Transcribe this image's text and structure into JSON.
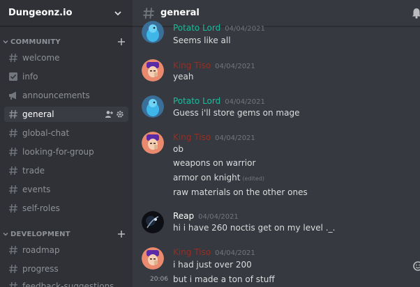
{
  "server": {
    "name": "Dungeonz.io"
  },
  "categories": [
    {
      "label": "COMMUNITY"
    },
    {
      "label": "DEVELOPMENT"
    }
  ],
  "channels": [
    {
      "label": "welcome",
      "icon": "hash-icon"
    },
    {
      "label": "info",
      "icon": "rules-icon"
    },
    {
      "label": "announcements",
      "icon": "megaphone-icon"
    },
    {
      "label": "general",
      "icon": "hash-icon",
      "active": true
    },
    {
      "label": "global-chat",
      "icon": "hash-icon"
    },
    {
      "label": "looking-for-group",
      "icon": "hash-icon"
    },
    {
      "label": "trade",
      "icon": "hash-icon"
    },
    {
      "label": "events",
      "icon": "hash-icon"
    },
    {
      "label": "self-roles",
      "icon": "hash-icon"
    },
    {
      "label": "roadmap",
      "icon": "hash-icon"
    },
    {
      "label": "progress",
      "icon": "hash-icon"
    },
    {
      "label": "feedback-suggestions",
      "icon": "hash-icon"
    }
  ],
  "header": {
    "channel": "general"
  },
  "colors": {
    "potato": "#1abc9c",
    "king": "#992d22",
    "reap": "#ffffff"
  },
  "messages": [
    {
      "author": "Potato Lord",
      "time": "04/04/2021",
      "lines": [
        "Seems like all"
      ]
    },
    {
      "author": "King Tiso",
      "time": "04/04/2021",
      "lines": [
        "yeah"
      ]
    },
    {
      "author": "Potato Lord",
      "time": "04/04/2021",
      "lines": [
        "Guess i'll store gems on mage"
      ]
    },
    {
      "author": "King Tiso",
      "time": "04/04/2021",
      "lines": [
        "ob",
        "weapons on warrior",
        "armor on knight",
        "raw materials on the other ones"
      ],
      "edited": "(edited)"
    },
    {
      "author": "Reap",
      "time": "04/04/2021",
      "lines": [
        "hi i have 260 noctis get on my level ._."
      ]
    },
    {
      "author": "King Tiso",
      "time": "04/04/2021",
      "lines": [
        "i had just over 200",
        "but i made a ton of stuff"
      ],
      "hover_time": "20:06"
    }
  ]
}
